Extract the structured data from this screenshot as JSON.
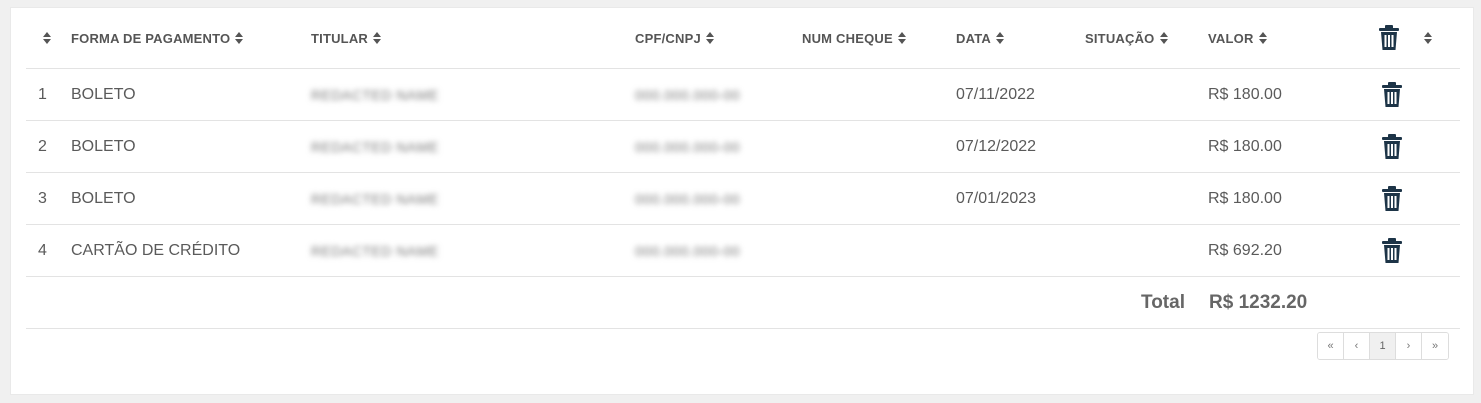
{
  "table": {
    "headers": {
      "index": "",
      "forma": "FORMA DE PAGAMENTO",
      "titular": "TITULAR",
      "cpf": "CPF/CNPJ",
      "cheque": "NUM CHEQUE",
      "data": "DATA",
      "situacao": "SITUAÇÃO",
      "valor": "VALOR"
    },
    "rows": [
      {
        "index": "1",
        "forma": "BOLETO",
        "titular": "REDACTED NAME",
        "cpf": "000.000.000-00",
        "cheque": "",
        "data": "07/11/2022",
        "situacao": "",
        "valor": "R$ 180.00"
      },
      {
        "index": "2",
        "forma": "BOLETO",
        "titular": "REDACTED NAME",
        "cpf": "000.000.000-00",
        "cheque": "",
        "data": "07/12/2022",
        "situacao": "",
        "valor": "R$ 180.00"
      },
      {
        "index": "3",
        "forma": "BOLETO",
        "titular": "REDACTED NAME",
        "cpf": "000.000.000-00",
        "cheque": "",
        "data": "07/01/2023",
        "situacao": "",
        "valor": "R$ 180.00"
      },
      {
        "index": "4",
        "forma": "CARTÃO DE CRÉDITO",
        "titular": "REDACTED NAME",
        "cpf": "000.000.000-00",
        "cheque": "",
        "data": "",
        "situacao": "",
        "valor": "R$ 692.20"
      }
    ],
    "total_label": "Total",
    "total_value": "R$ 1232.20"
  },
  "pagination": {
    "first": "«",
    "prev": "‹",
    "current": "1",
    "next": "›",
    "last": "»"
  },
  "colors": {
    "trash_icon": "#1d3447"
  }
}
